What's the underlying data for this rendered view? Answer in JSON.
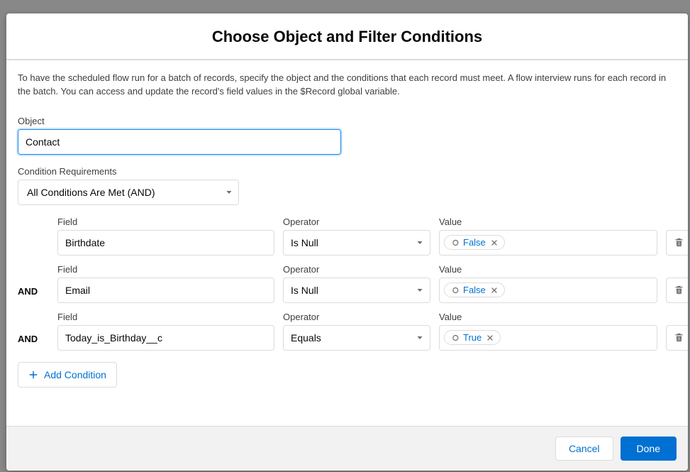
{
  "header": {
    "title": "Choose Object and Filter Conditions"
  },
  "description": "To have the scheduled flow run for a batch of records, specify the object and the conditions that each record must meet. A flow interview runs for each record in the batch. You can access and update the record's field values in the $Record global variable.",
  "object": {
    "label": "Object",
    "value": "Contact"
  },
  "requirements": {
    "label": "Condition Requirements",
    "value": "All Conditions Are Met (AND)"
  },
  "columns": {
    "field": "Field",
    "operator": "Operator",
    "value": "Value"
  },
  "logic_prefix": "AND",
  "conditions": [
    {
      "field": "Birthdate",
      "operator": "Is Null",
      "value": "False"
    },
    {
      "field": "Email",
      "operator": "Is Null",
      "value": "False"
    },
    {
      "field": "Today_is_Birthday__c",
      "operator": "Equals",
      "value": "True"
    }
  ],
  "add_label": "Add Condition",
  "footer": {
    "cancel": "Cancel",
    "done": "Done"
  }
}
